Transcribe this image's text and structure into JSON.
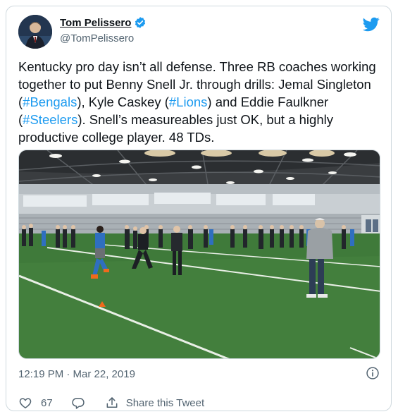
{
  "author": {
    "display_name": "Tom Pelissero",
    "handle": "@TomPelissero",
    "verified": true
  },
  "tweet": {
    "text_parts": [
      {
        "text": "Kentucky pro day isn’t all defense. Three RB coaches working together to put Benny Snell Jr. through drills: Jemal Singleton (",
        "kind": "plain"
      },
      {
        "text": "#Bengals",
        "kind": "hashtag"
      },
      {
        "text": "), Kyle Caskey (",
        "kind": "plain"
      },
      {
        "text": "#Lions",
        "kind": "hashtag"
      },
      {
        "text": ") and Eddie Faulkner (",
        "kind": "plain"
      },
      {
        "text": "#Steelers",
        "kind": "hashtag"
      },
      {
        "text": "). Snell’s measureables just OK, but a highly productive college player. 48 TDs.",
        "kind": "plain"
      }
    ],
    "timestamp": "12:19 PM · Mar 22, 2019"
  },
  "actions": {
    "like_count": "67",
    "share_label": "Share this Tweet"
  },
  "colors": {
    "accent": "#1d9bf0",
    "text": "#0f1419",
    "muted": "#536471",
    "border": "#cfd9de",
    "turf": "#3f7a3a"
  },
  "icons": [
    "twitter-bird-icon",
    "verified-badge-icon",
    "info-icon",
    "heart-icon",
    "reply-icon",
    "share-icon"
  ]
}
